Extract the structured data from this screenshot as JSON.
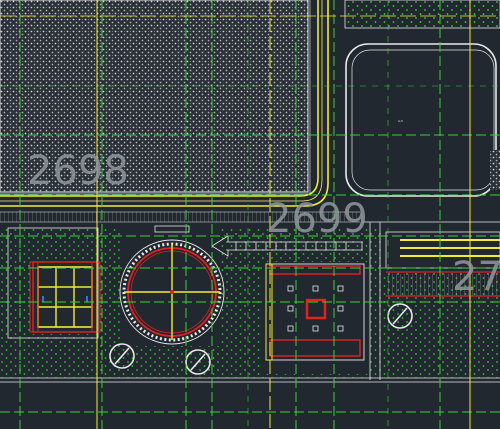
{
  "drawing": {
    "background": "#212830",
    "colors": {
      "yellow": "#f0ea3a",
      "green": "#39d139",
      "white": "#e8e8e8",
      "red": "#e0231f",
      "hatch": "#bfbfbf",
      "label": "#8f969c"
    },
    "plot_labels": [
      "2698",
      "2699",
      "27"
    ],
    "building_icons": [
      "circular-tank-symbol",
      "rectangular-unit-symbol",
      "tree-symbol",
      "hatched-building"
    ]
  }
}
